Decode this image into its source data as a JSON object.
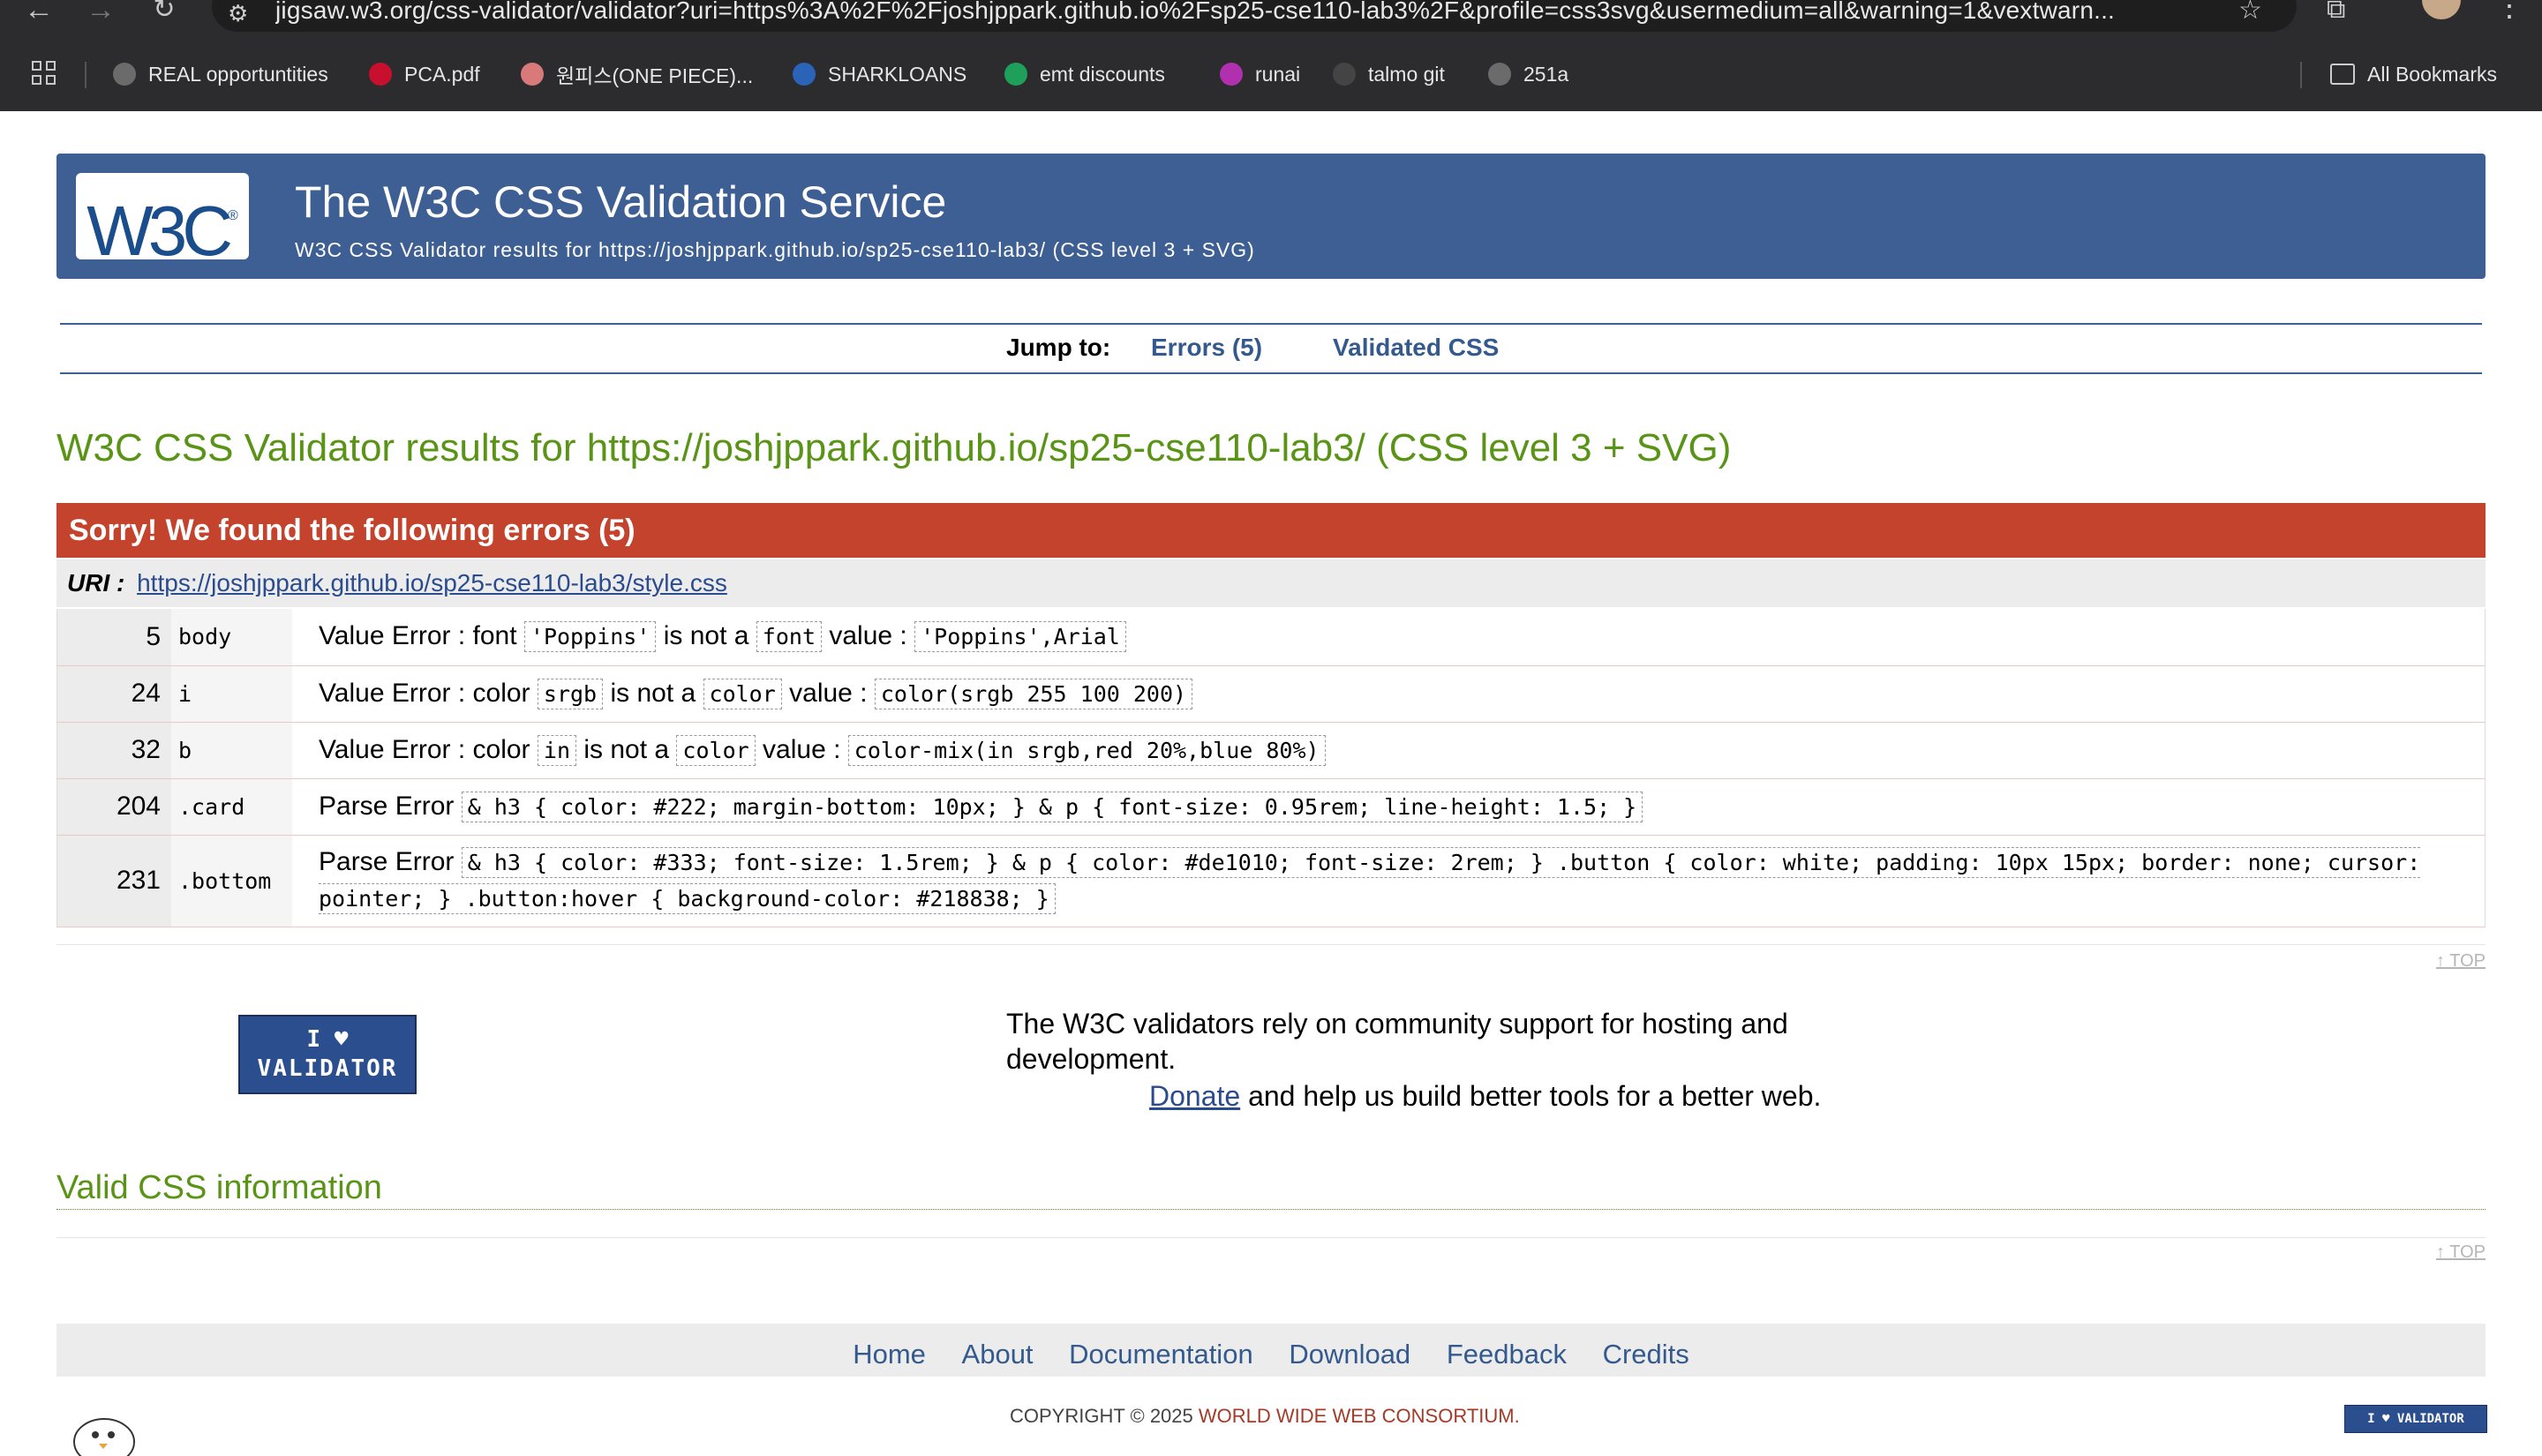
{
  "browser": {
    "url": "jigsaw.w3.org/css-validator/validator?uri=https%3A%2F%2Fjoshjppark.github.io%2Fsp25-cse110-lab3%2F&profile=css3svg&usermedium=all&warning=1&vextwarn...",
    "bookmarks": [
      {
        "label": "REAL opportuntities",
        "icon": "globe-icon",
        "color": "#6b6b6b"
      },
      {
        "label": "PCA.pdf",
        "icon": "u-shield-icon",
        "color": "#c8102e"
      },
      {
        "label": "원피스(ONE PIECE)...",
        "icon": "flower-icon",
        "color": "#d97a7a"
      },
      {
        "label": "SHARKLOANS",
        "icon": "ed-icon",
        "color": "#2a63b8"
      },
      {
        "label": "emt discounts",
        "icon": "cart-icon",
        "color": "#1fa05a"
      },
      {
        "label": "runai",
        "icon": "dot-icon",
        "color": "#b030b0"
      },
      {
        "label": "talmo git",
        "icon": "github-icon",
        "color": "#444444"
      },
      {
        "label": "251a",
        "icon": "globe-icon",
        "color": "#6b6b6b"
      }
    ],
    "all_bookmarks": "All Bookmarks"
  },
  "banner": {
    "logo": "W3C",
    "title": "The W3C CSS Validation Service",
    "subtitle": "W3C CSS Validator results for https://joshjppark.github.io/sp25-cse110-lab3/ (CSS level 3 + SVG)"
  },
  "jump": {
    "label": "Jump to:",
    "errors_link": "Errors (5)",
    "validated_link": "Validated CSS"
  },
  "results_heading": "W3C CSS Validator results for https://joshjppark.github.io/sp25-cse110-lab3/ (CSS level 3 + SVG)",
  "errors": {
    "header": "Sorry! We found the following errors (5)",
    "uri_label": "URI :",
    "uri": "https://joshjppark.github.io/sp25-cse110-lab3/style.css",
    "rows": [
      {
        "line": "5",
        "context": "body",
        "type": "Value Error :",
        "parts": [
          "font",
          "'Poppins'",
          "is not a",
          "font",
          "value :",
          "'Poppins',Arial"
        ]
      },
      {
        "line": "24",
        "context": "i",
        "type": "Value Error :",
        "parts": [
          "color",
          "srgb",
          "is not a",
          "color",
          "value :",
          "color(srgb 255 100 200)"
        ]
      },
      {
        "line": "32",
        "context": "b",
        "type": "Value Error :",
        "parts": [
          "color",
          "in",
          "is not a",
          "color",
          "value :",
          "color-mix(in srgb,red 20%,blue 80%)"
        ]
      },
      {
        "line": "204",
        "context": ".card",
        "type": "Parse Error",
        "code": "& h3 { color: #222; margin-bottom: 10px; } & p { font-size: 0.95rem; line-height: 1.5; }"
      },
      {
        "line": "231",
        "context": ".bottom",
        "type": "Parse Error",
        "code": "& h3 { color: #333; font-size: 1.5rem; } & p { color: #de1010; font-size: 2rem; } .button { color: white; padding: 10px 15px; border: none; cursor: pointer; } .button:hover { background-color: #218838; }"
      }
    ]
  },
  "top_link": "↑ TOP",
  "support": {
    "badge_line1": "I ♥",
    "badge_line2": "VALIDATOR",
    "text": "The W3C validators rely on community support for hosting and development.",
    "donate": "Donate",
    "donate_rest": " and help us build better tools for a better web."
  },
  "valid_heading": "Valid CSS information",
  "footer": {
    "links": [
      "Home",
      "About",
      "Documentation",
      "Download",
      "Feedback",
      "Credits"
    ],
    "copyright_prefix": "COPYRIGHT © 2025 ",
    "copyright_org": "WORLD WIDE WEB CONSORTIUM.",
    "badge": "I ♥ VALIDATOR"
  },
  "colors": {
    "banner": "#3e5f93",
    "error_header": "#c3432d",
    "heading_green": "#5a9417",
    "link_blue": "#34598f"
  }
}
